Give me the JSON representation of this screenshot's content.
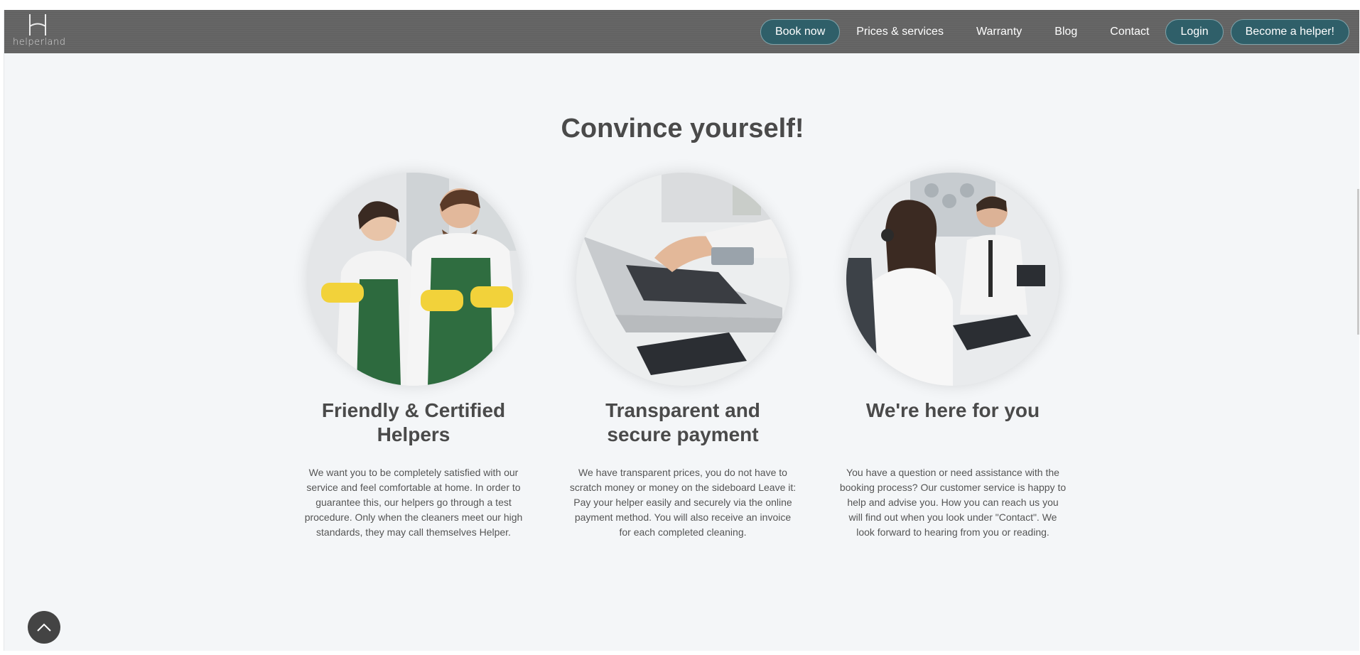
{
  "brand": {
    "logo_text": "helperland"
  },
  "nav": {
    "book_now": "Book now",
    "prices": "Prices & services",
    "warranty": "Warranty",
    "blog": "Blog",
    "contact": "Contact",
    "login": "Login",
    "become_helper": "Become a helper!"
  },
  "main": {
    "heading": "Convince yourself!",
    "cards": [
      {
        "title_line1": "Friendly & Certified",
        "title_line2": "Helpers",
        "text": "We want you to be completely satisfied with our service and feel comfortable at home. In order to guarantee this, our helpers go through a test procedure. Only when the cleaners meet our high standards, they may call themselves Helper."
      },
      {
        "title_line1": "Transparent and",
        "title_line2": "secure payment",
        "text": "We have transparent prices, you do not have to scratch money or money on the sideboard Leave it: Pay your helper easily and securely via the online payment method. You will also receive an invoice for each completed cleaning."
      },
      {
        "title_line1": "We're here for you",
        "title_line2": "",
        "text": "You have a question or need assistance with the booking process? Our customer service is happy to help and advise you. How you can reach us you will find out when you look under \"Contact\". We look forward to hearing from you or reading."
      }
    ]
  },
  "icons": {
    "logo": "helperland-logo-icon",
    "scroll_top": "chevron-up-icon"
  },
  "colors": {
    "navbar": "#666666",
    "pill": "#2f5f69",
    "background": "#f4f6f8",
    "heading": "#4a4a4a"
  }
}
